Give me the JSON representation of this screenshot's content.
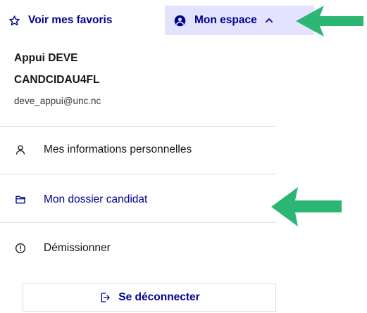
{
  "header": {
    "favorites_label": "Voir mes favoris",
    "espace_label": "Mon espace"
  },
  "user": {
    "name": "Appui DEVE",
    "code": "CANDCIDAU4FL",
    "email": "deve_appui@unc.nc"
  },
  "menu": {
    "items": [
      {
        "label": "Mes informations personnelles",
        "icon": "user-icon"
      },
      {
        "label": "Mon dossier candidat",
        "icon": "folder-icon"
      },
      {
        "label": "Démissionner",
        "icon": "warning-circle-icon"
      }
    ]
  },
  "logout": {
    "label": "Se déconnecter",
    "icon": "logout-icon"
  },
  "colors": {
    "accent": "#000091",
    "accent_bg": "#e3e3fd",
    "arrow": "#2bb673",
    "divider": "#dddddd",
    "text": "#161616"
  }
}
